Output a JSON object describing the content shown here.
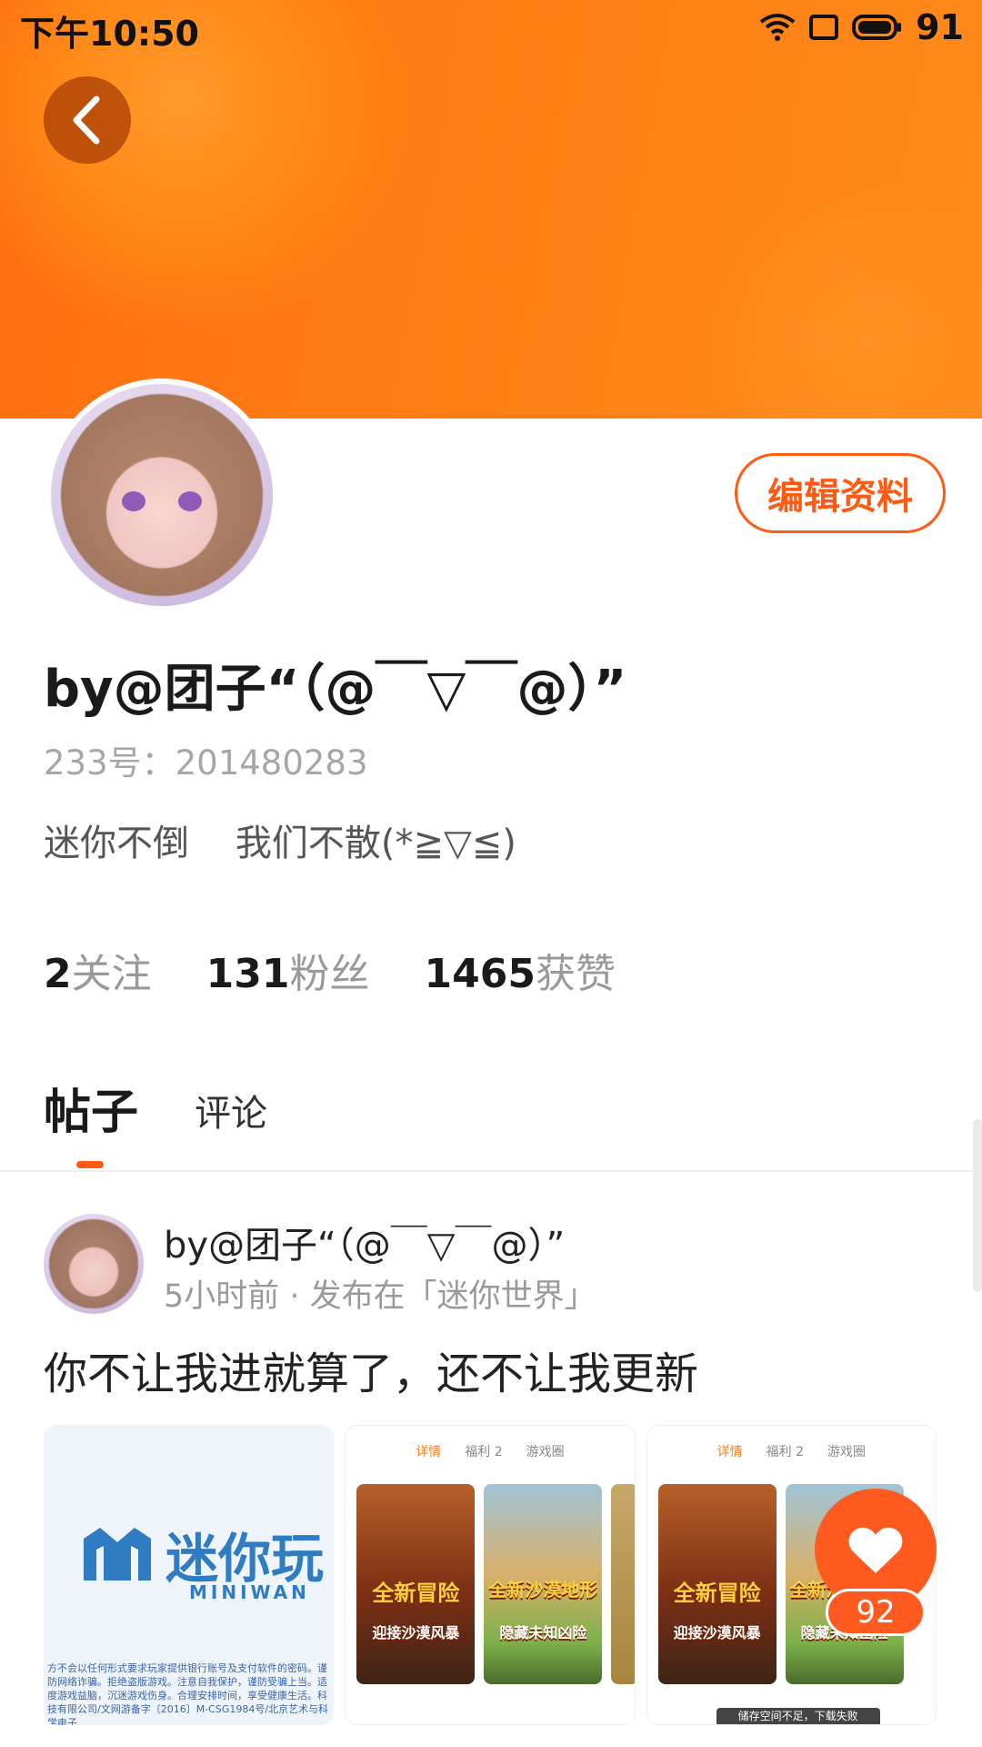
{
  "status_bar": {
    "time": "下午10:50",
    "battery": "91"
  },
  "profile": {
    "edit_label": "编辑资料",
    "name": "by@团子“（@￣▽￣@）”",
    "id_text": "233号：201480283",
    "bio": "迷你不倒    我们不散(*≧▽≦)",
    "stats": [
      {
        "num": "2",
        "label": "关注"
      },
      {
        "num": "131",
        "label": "粉丝"
      },
      {
        "num": "1465",
        "label": "获赞"
      }
    ]
  },
  "tabs": [
    {
      "label": "帖子"
    },
    {
      "label": "评论"
    }
  ],
  "post": {
    "author": "by@团子“（@￣▽￣@）”",
    "meta": "5小时前 · 发布在「迷你世界」",
    "text": "你不让我进就算了，还不让我更新",
    "images": {
      "logo_text": "迷你玩",
      "logo_sub": "MINIWAN",
      "fine_print": "方不会以任何形式要求玩家提供银行账号及支付软件的密码。谨防网络诈骗。拒绝盗版游戏。注意自我保护，谨防受骗上当。适度游戏益脑，沉迷游戏伤身。合理安排时间，享受健康生活。科技有限公司/文网游备字〔2016〕M-CSG1984号/北京艺术与科学电子",
      "ss_tabs": [
        "详情",
        "福利 2",
        "游戏圈"
      ],
      "tile1_title": "全新冒险",
      "tile1_sub": "迎接沙漠风暴",
      "tile2_title": "全新沙漠地形",
      "tile2_sub": "隐藏未知凶险",
      "toast": "储存空间不足，下载失败"
    },
    "likes": "92"
  }
}
